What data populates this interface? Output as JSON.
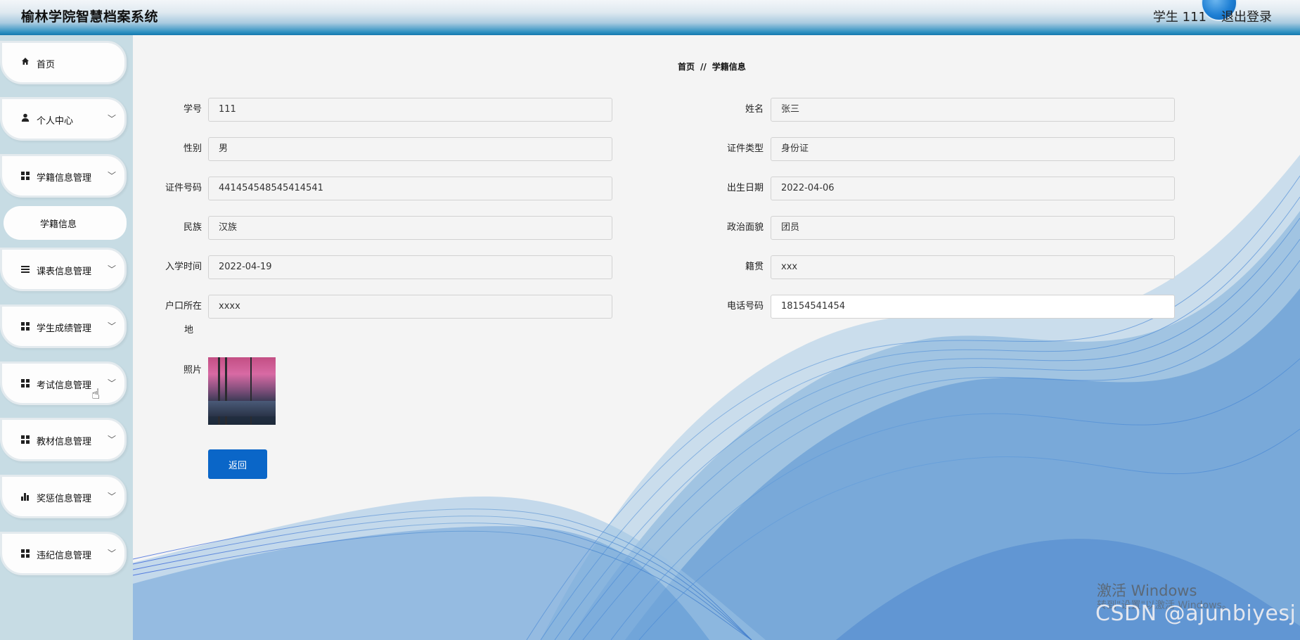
{
  "header": {
    "app_title": "榆林学院智慧档案系统",
    "user_name": "学生 111",
    "logout_label": "退出登录"
  },
  "sidebar": {
    "items": [
      {
        "label": "首页",
        "icon": "home-icon"
      },
      {
        "label": "个人中心",
        "icon": "user-icon"
      },
      {
        "label": "学籍信息管理",
        "icon": "grid-icon"
      },
      {
        "label": "学籍信息",
        "icon": ""
      },
      {
        "label": "课表信息管理",
        "icon": "list-icon"
      },
      {
        "label": "学生成绩管理",
        "icon": "grid-icon"
      },
      {
        "label": "考试信息管理",
        "icon": "grid-icon"
      },
      {
        "label": "教材信息管理",
        "icon": "grid-icon"
      },
      {
        "label": "奖惩信息管理",
        "icon": "bar-chart-icon"
      },
      {
        "label": "违纪信息管理",
        "icon": "grid-icon"
      }
    ]
  },
  "breadcrumb": {
    "home": "首页",
    "separator": "//",
    "current": "学籍信息"
  },
  "form": {
    "student_id": {
      "label": "学号",
      "value": "111"
    },
    "name": {
      "label": "姓名",
      "value": "张三"
    },
    "gender": {
      "label": "性别",
      "value": "男"
    },
    "id_type": {
      "label": "证件类型",
      "value": "身份证"
    },
    "id_number": {
      "label": "证件号码",
      "value": "441454548545414541"
    },
    "birth_date": {
      "label": "出生日期",
      "value": "2022-04-06"
    },
    "ethnicity": {
      "label": "民族",
      "value": "汉族"
    },
    "political_status": {
      "label": "政治面貌",
      "value": "团员"
    },
    "enrollment_date": {
      "label": "入学时间",
      "value": "2022-04-19"
    },
    "native_place": {
      "label": "籍贯",
      "value": "xxx"
    },
    "household_location": {
      "label_line1": "户口所在",
      "label_line2": "地",
      "value": "xxxx"
    },
    "phone": {
      "label": "电话号码",
      "value": "18154541454"
    },
    "photo": {
      "label": "照片"
    }
  },
  "actions": {
    "back_label": "返回"
  },
  "watermarks": {
    "windows_line1": "激活 Windows",
    "windows_line2": "转到\"设置\"以激活 Windows。",
    "csdn": "CSDN @ajunbiyesj"
  },
  "colors": {
    "primary_button": "#0a66c8",
    "header_bottom": "#1578ae",
    "sidebar_bg": "#c7dce4"
  }
}
